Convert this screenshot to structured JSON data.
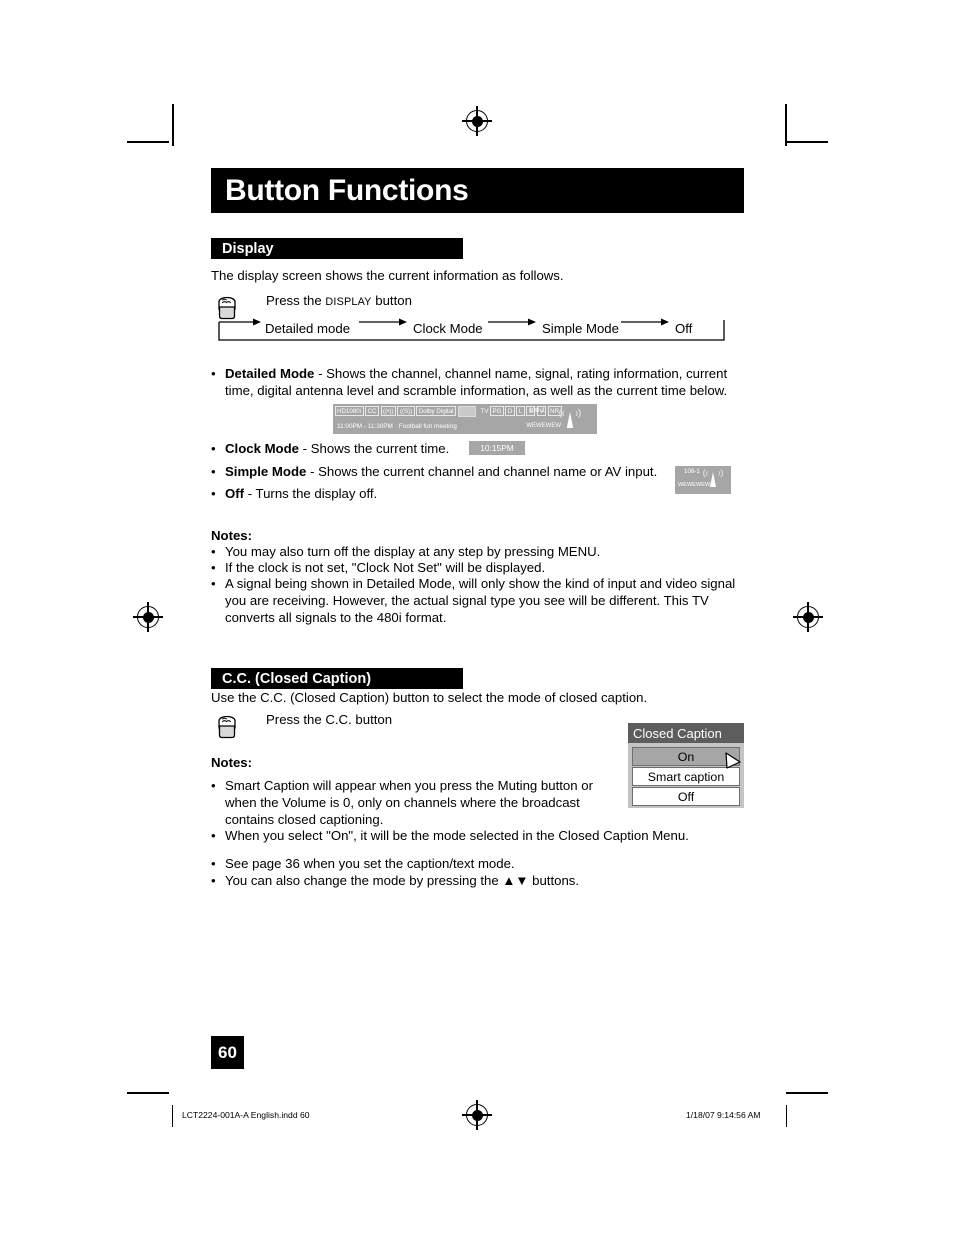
{
  "document": {
    "title": "Button Functions",
    "page_number": "60"
  },
  "display_section": {
    "heading": "Display",
    "intro": "The display screen shows the current information as follows.",
    "press_instruction_prefix": "Press the ",
    "press_instruction_key": "DISPLAY",
    "press_instruction_suffix": " button",
    "flow": [
      "Detailed mode",
      "Clock Mode",
      "Simple Mode",
      "Off"
    ],
    "bullets": [
      {
        "term": "Detailed Mode",
        "text": " - Shows the channel, channel name, signal, rating information, current time, digital antenna level and scramble information, as well as the current time below."
      },
      {
        "term": "Clock Mode",
        "text": " - Shows the current time."
      },
      {
        "term": "Simple Mode",
        "text": " - Shows the current channel and channel name or AV input."
      },
      {
        "term": "Off",
        "text": " - Turns the display off."
      }
    ],
    "notes_heading": "Notes:",
    "notes": [
      "You may also turn off the display at any step by pressing MENU.",
      "If the clock is not set, \"Clock Not Set\" will be displayed.",
      "A signal being shown in Detailed Mode, will only show the kind of input and video signal you are receiving.  However, the actual signal type you see will be different.  This TV converts all signals to the 480i format."
    ]
  },
  "osd_detailed": {
    "chips": [
      "HD1080i",
      "CC",
      "((•))",
      "((S))",
      "Dolby Digital"
    ],
    "blank_chip": "",
    "rating_prefix": "TV",
    "rating": "PG",
    "rating_flags": [
      "D",
      "L",
      "S",
      "V",
      "NR"
    ],
    "channel": "108-1",
    "time_range": "11:00PM - 11:30PM",
    "program": "Football fun meeting",
    "call_sign": "WEWEWEW",
    "antenna_icon": "antenna-signal-icon",
    "background_color": "#a6a6a6"
  },
  "osd_clock": {
    "time": "10:15PM"
  },
  "osd_simple": {
    "channel": "108-1",
    "call_sign": "WEWEWEW",
    "antenna_icon": "antenna-signal-icon"
  },
  "cc_section": {
    "heading": "C.C. (Closed Caption)",
    "intro": "Use the C.C. (Closed Caption) button to select the mode of closed caption.",
    "press_instruction": "Press the C.C. button",
    "notes_heading": "Notes:",
    "notes": [
      "Smart Caption will appear when you press the Muting button or when the Volume is 0, only on channels where the broadcast contains closed captioning.",
      "When you select \"On\", it will be the mode selected in the Closed Caption Menu.",
      "See page 36 when you set the caption/text mode.",
      "You can also change the mode by pressing the ▲▼ buttons."
    ]
  },
  "cc_menu": {
    "title": "Closed Caption",
    "items": [
      {
        "label": "On",
        "selected": true
      },
      {
        "label": "Smart caption",
        "selected": false
      },
      {
        "label": "Off",
        "selected": false
      }
    ],
    "cursor_icon": "pointer-arrow-icon",
    "title_bg": "#5d5d5d",
    "selected_bg": "#a6a6a6"
  },
  "footer": {
    "file_name": "LCT2224-001A-A English.indd   60",
    "timestamp": "1/18/07   9:14:56 AM"
  },
  "print_marks": {
    "registration_icon": "registration-target-icon",
    "crop_icon": "crop-mark-icon"
  }
}
